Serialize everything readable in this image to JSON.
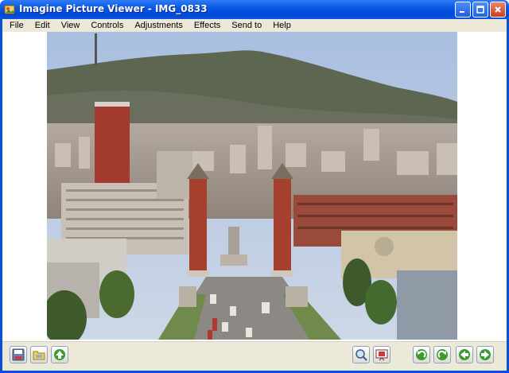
{
  "window": {
    "title": "Imagine Picture Viewer - IMG_0833"
  },
  "menu": {
    "items": [
      "File",
      "Edit",
      "View",
      "Controls",
      "Adjustments",
      "Effects",
      "Send to",
      "Help"
    ]
  },
  "title_buttons": [
    "minimize-icon",
    "maximize-icon",
    "close-icon"
  ],
  "toolbar": {
    "left_tools": [
      "save-icon",
      "open-folder-icon",
      "up-arrow-icon"
    ],
    "right_tools": [
      "zoom-icon",
      "slideshow-icon",
      "rotate-left-icon",
      "rotate-right-icon",
      "previous-icon",
      "next-icon"
    ]
  },
  "colors": {
    "title_bar": "#0a58e6",
    "chrome": "#ece9d8",
    "tool_green": "#3c9a2e"
  }
}
